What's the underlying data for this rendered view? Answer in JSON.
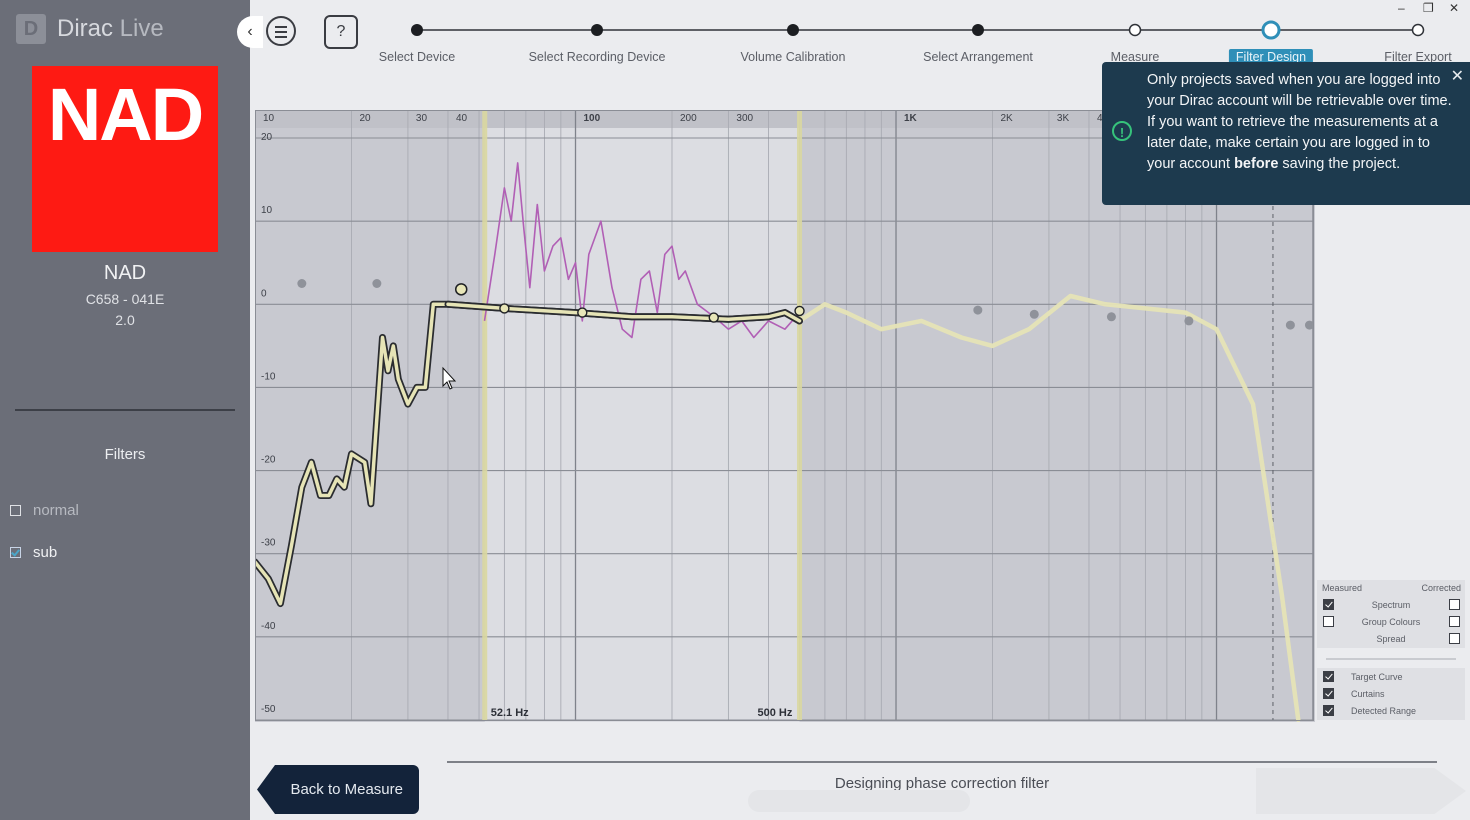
{
  "app": {
    "logo_glyph": "D",
    "name_main": "Dirac",
    "name_sub": " Live"
  },
  "sidebar": {
    "brand_logo_text": "NAD",
    "device_name": "NAD",
    "device_model": "C658 - 041E",
    "device_channels": "2.0",
    "filters_title": "Filters",
    "filters": [
      {
        "label": "normal",
        "checked": false
      },
      {
        "label": "sub",
        "checked": true
      }
    ],
    "collapse_glyph": "‹"
  },
  "toolbar": {
    "help_glyph": "?"
  },
  "steps": [
    {
      "label": "Select Device",
      "state": "done"
    },
    {
      "label": "Select Recording Device",
      "state": "done"
    },
    {
      "label": "Volume Calibration",
      "state": "done"
    },
    {
      "label": "Select Arrangement",
      "state": "done"
    },
    {
      "label": "Measure",
      "state": "todo"
    },
    {
      "label": "Filter Design",
      "state": "active"
    },
    {
      "label": "Filter Export",
      "state": "todo"
    }
  ],
  "window_controls": {
    "minimize": "–",
    "restore": "❐",
    "close": "✕"
  },
  "toast": {
    "text_before": "Only projects saved when you are logged into your Dirac account will be retrievable over time. If you want to retrieve the measurements at a later date, make certain you are logged in to your account ",
    "text_bold": "before",
    "text_after": " saving the project.",
    "icon_glyph": "!",
    "close_glyph": "✕"
  },
  "chart_data": {
    "type": "line",
    "x_scale": "log",
    "xlim": [
      10,
      20000
    ],
    "ylim": [
      -50,
      20
    ],
    "x_tick_labels": [
      {
        "f": 10,
        "label": "10"
      },
      {
        "f": 20,
        "label": "20"
      },
      {
        "f": 30,
        "label": "30"
      },
      {
        "f": 40,
        "label": "40"
      },
      {
        "f": 100,
        "label": "100"
      },
      {
        "f": 200,
        "label": "200"
      },
      {
        "f": 300,
        "label": "300"
      },
      {
        "f": 1000,
        "label": "1K"
      },
      {
        "f": 2000,
        "label": "2K"
      },
      {
        "f": 3000,
        "label": "3K"
      },
      {
        "f": 4000,
        "label": "4K"
      }
    ],
    "y_ticks": [
      20,
      10,
      0,
      -10,
      -20,
      -30,
      -40,
      -50
    ],
    "curtains": [
      {
        "freq": 52.1,
        "label": "52.1 Hz"
      },
      {
        "freq": 500,
        "label": "500 Hz"
      }
    ],
    "series": [
      {
        "role": "target_curve",
        "color": "#e6e4b6",
        "points": [
          [
            10,
            -31
          ],
          [
            11,
            -33
          ],
          [
            12,
            -36
          ],
          [
            13,
            -29
          ],
          [
            14,
            -22
          ],
          [
            15,
            -19
          ],
          [
            16,
            -23
          ],
          [
            17,
            -23
          ],
          [
            18,
            -21
          ],
          [
            19,
            -22
          ],
          [
            20,
            -18
          ],
          [
            22,
            -19
          ],
          [
            23,
            -24
          ],
          [
            25,
            -4
          ],
          [
            26,
            -8
          ],
          [
            27,
            -5
          ],
          [
            28,
            -9
          ],
          [
            30,
            -12
          ],
          [
            32,
            -10
          ],
          [
            34,
            -10
          ],
          [
            36,
            0
          ],
          [
            40,
            0
          ],
          [
            60,
            -0.5
          ],
          [
            100,
            -1
          ],
          [
            150,
            -1.5
          ],
          [
            200,
            -1.5
          ],
          [
            300,
            -1.8
          ],
          [
            400,
            -1.5
          ],
          [
            450,
            -1
          ],
          [
            500,
            -2
          ],
          [
            600,
            0
          ],
          [
            700,
            -1
          ],
          [
            900,
            -3
          ],
          [
            1200,
            -2
          ],
          [
            1600,
            -4
          ],
          [
            2000,
            -5
          ],
          [
            2600,
            -3
          ],
          [
            3500,
            1
          ],
          [
            4500,
            0
          ],
          [
            6000,
            -0.5
          ],
          [
            8000,
            -1
          ],
          [
            10000,
            -3
          ],
          [
            13000,
            -12
          ],
          [
            16000,
            -35
          ],
          [
            18000,
            -50
          ]
        ]
      },
      {
        "role": "measured_in_range",
        "color": "#b15fb5",
        "points": [
          [
            52,
            -2
          ],
          [
            56,
            6
          ],
          [
            60,
            14
          ],
          [
            63,
            10
          ],
          [
            66,
            17
          ],
          [
            69,
            9
          ],
          [
            72,
            2
          ],
          [
            76,
            12
          ],
          [
            80,
            4
          ],
          [
            85,
            7
          ],
          [
            90,
            8
          ],
          [
            95,
            3
          ],
          [
            100,
            5
          ],
          [
            105,
            -2
          ],
          [
            110,
            6
          ],
          [
            120,
            10
          ],
          [
            130,
            2
          ],
          [
            140,
            -3
          ],
          [
            150,
            -4
          ],
          [
            160,
            3
          ],
          [
            170,
            4
          ],
          [
            180,
            -1
          ],
          [
            190,
            6
          ],
          [
            200,
            7
          ],
          [
            210,
            3
          ],
          [
            220,
            4
          ],
          [
            240,
            0
          ],
          [
            260,
            -1
          ],
          [
            280,
            -2
          ],
          [
            300,
            -3
          ],
          [
            330,
            -2
          ],
          [
            360,
            -4
          ],
          [
            400,
            -2
          ],
          [
            450,
            -3
          ],
          [
            500,
            -1
          ]
        ]
      }
    ],
    "target_points": [
      {
        "f": 44,
        "db": 1.8,
        "style": "open"
      },
      {
        "f": 60,
        "db": -0.5,
        "style": "small"
      },
      {
        "f": 105,
        "db": -1,
        "style": "small"
      },
      {
        "f": 270,
        "db": -1.6,
        "style": "small"
      },
      {
        "f": 500,
        "db": -0.8,
        "style": "small"
      }
    ],
    "reference_points": [
      {
        "f": 14,
        "db": 2.5
      },
      {
        "f": 24,
        "db": 2.5
      },
      {
        "f": 1800,
        "db": -0.7
      },
      {
        "f": 2700,
        "db": -1.2
      },
      {
        "f": 4700,
        "db": -1.5
      },
      {
        "f": 8200,
        "db": -2
      },
      {
        "f": 17000,
        "db": -2.5
      },
      {
        "f": 19500,
        "db": -2.5
      }
    ],
    "dashed_marker_freq": 15000
  },
  "legend": {
    "measured_label": "Measured",
    "corrected_label": "Corrected",
    "rows": [
      {
        "label": "Spectrum",
        "measured": true,
        "corrected": false
      },
      {
        "label": "Group Colours",
        "measured": false,
        "corrected": false
      },
      {
        "label": "Spread",
        "measured": null,
        "corrected": false
      }
    ],
    "options": [
      {
        "label": "Target Curve",
        "checked": true
      },
      {
        "label": "Curtains",
        "checked": true
      },
      {
        "label": "Detected Range",
        "checked": true
      }
    ]
  },
  "footer": {
    "back_label": "Back to Measure",
    "status": "Designing phase correction filter"
  }
}
